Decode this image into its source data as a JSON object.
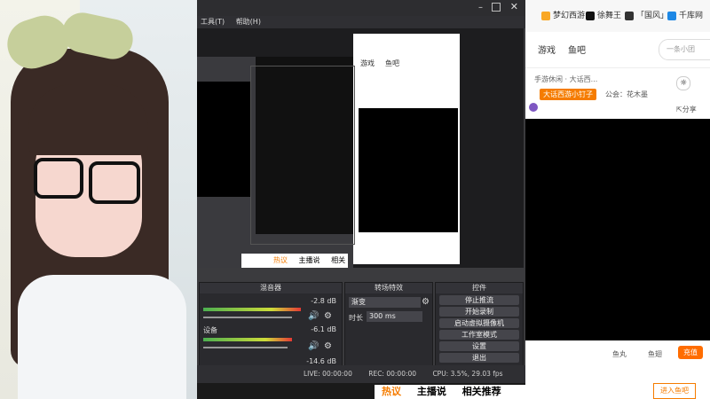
{
  "obs": {
    "menu": [
      "工具(T)",
      "帮助(H)"
    ],
    "docks": {
      "mixer": {
        "title": "混音器",
        "levels": [
          "-2.8 dB",
          "-6.1 dB",
          "-14.6 dB"
        ],
        "device_label": "设备"
      },
      "transition": {
        "title": "转场特效",
        "select": "渐变",
        "duration_label": "时长",
        "duration_value": "300 ms"
      },
      "controls": {
        "title": "控件",
        "buttons": [
          "停止推流",
          "开始录制",
          "启动虚拟摄像机",
          "工作室模式",
          "设置",
          "退出"
        ]
      }
    },
    "status": {
      "live": "LIVE: 00:00:00",
      "rec": "REC: 00:00:00",
      "cpu": "CPU: 3.5%, 29.03 fps"
    }
  },
  "browser": {
    "bookmarks": [
      "梦幻西游",
      "徐舞王",
      "「国风」",
      "千库网"
    ],
    "nav": [
      "游戏",
      "鱼吧"
    ],
    "search_placeholder": "一条小团",
    "tags": [
      "手游休闲 · 大话西...",
      "大话西游小钉子",
      "公会：花木墨"
    ],
    "share": "分享",
    "bottom_tabs": [
      "热议",
      "主播说",
      "相关推荐"
    ],
    "enter_bar": "进入鱼吧",
    "footer_items": [
      "鱼丸",
      "鱼翅",
      "充值"
    ]
  },
  "inner_page": {
    "nav": [
      "游戏",
      "鱼吧"
    ],
    "tabs": [
      "热议",
      "主播说",
      "相关推荐"
    ]
  }
}
